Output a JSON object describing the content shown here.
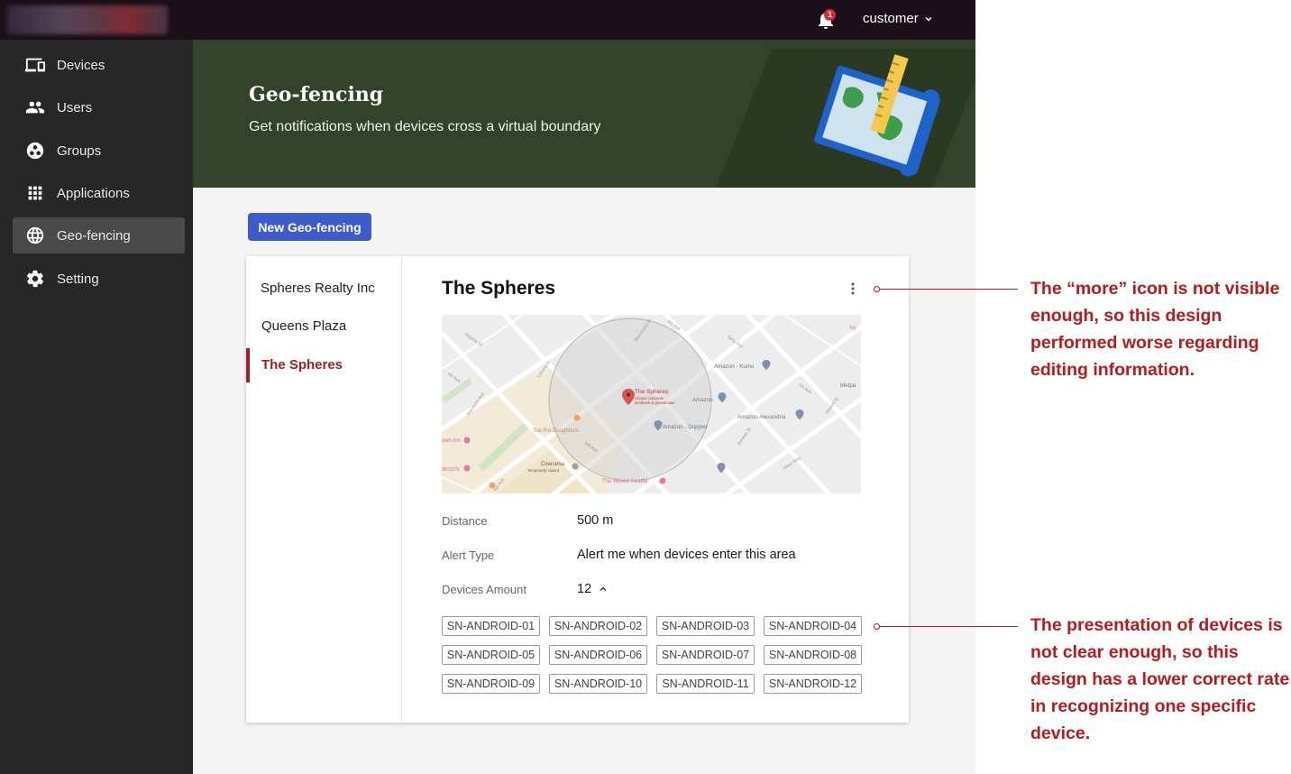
{
  "topbar": {
    "notification_count": "1",
    "user_label": "customer"
  },
  "sidebar": {
    "items": [
      {
        "label": "Devices",
        "icon": "devices-icon",
        "active": false
      },
      {
        "label": "Users",
        "icon": "users-icon",
        "active": false
      },
      {
        "label": "Groups",
        "icon": "groups-icon",
        "active": false
      },
      {
        "label": "Applications",
        "icon": "apps-grid-icon",
        "active": false
      },
      {
        "label": "Geo-fencing",
        "icon": "globe-icon",
        "active": true
      },
      {
        "label": "Setting",
        "icon": "gear-icon",
        "active": false
      }
    ]
  },
  "banner": {
    "title": "Geo-fencing",
    "subtitle": "Get notifications when devices cross a virtual boundary"
  },
  "actions": {
    "new_label": "New Geo-fencing"
  },
  "locations": {
    "items": [
      "Spheres Realty Inc",
      "Queens Plaza",
      "The Spheres"
    ],
    "selected": "The Spheres"
  },
  "detail": {
    "title": "The Spheres",
    "map_labels": {
      "pin": "The Spheres",
      "pin_sub1": "Unique corporate",
      "pin_sub2": "landmark & greenhouse",
      "amazon_kumo": "Amazon - Kumo",
      "amazon": "Amazon",
      "amazon_doppler": "Amazon - Doppler",
      "amazon_alexandria": "Amazon Alexandria",
      "top_pot": "Top Pot Doughnuts",
      "cinerama": "Cinerama",
      "cinerama_sub": "Temporarily closed",
      "westin": "The Westin Seattle",
      "metpark": "Metpa",
      "own_inn": "own Inn",
      "acco": "acco's",
      "by": "by",
      "street_4th": "4th Ave",
      "street_5th": "5th Ave",
      "street_6th": "6th Ave",
      "street_7th": "7th Ave",
      "street_lenora": "Lenora St",
      "street_blanchard": "Blanchard St",
      "street_terry": "Terry Ave",
      "street_howell": "Howell St",
      "street_stewart": "Stewart St",
      "street_olive": "Olive Way",
      "street_westlake": "Westlake Ave",
      "street_9th": "9th Ave",
      "street_virginia": "Virginia St"
    },
    "fields": {
      "distance_label": "Distance",
      "distance_value": "500 m",
      "alert_label": "Alert Type",
      "alert_value": "Alert me when devices enter this area",
      "amount_label": "Devices Amount",
      "amount_value": "12"
    },
    "devices": [
      "SN-ANDROID-01",
      "SN-ANDROID-02",
      "SN-ANDROID-03",
      "SN-ANDROID-04",
      "SN-ANDROID-05",
      "SN-ANDROID-06",
      "SN-ANDROID-07",
      "SN-ANDROID-08",
      "SN-ANDROID-09",
      "SN-ANDROID-10",
      "SN-ANDROID-11",
      "SN-ANDROID-12"
    ]
  },
  "annotations": [
    "The “more” icon is not visible enough, so this design performed worse regarding editing information.",
    "The presentation of devices is not clear enough, so this design has a lower correct rate in recognizing one specific device."
  ],
  "colors": {
    "topbar": "#1c0f19",
    "sidebar": "#272727",
    "banner": "#33432a",
    "primary_button": "#3d5bc9",
    "selected_accent": "#a32020",
    "annotation": "#b71c1c"
  }
}
